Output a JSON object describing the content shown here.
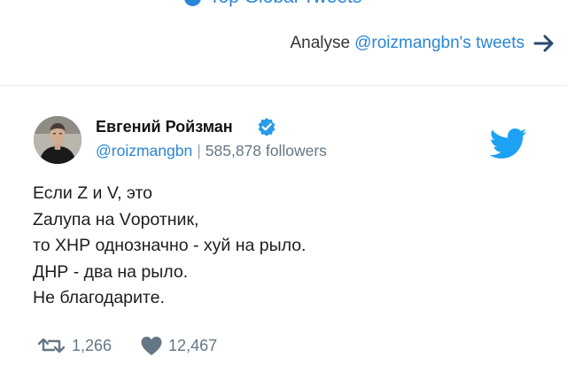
{
  "top_section": {
    "label": "Top Global Tweets"
  },
  "analyse_link": {
    "prefix": "Analyse",
    "handle": "@roizmangbn's tweets",
    "arrow_icon": "arrow-right-icon"
  },
  "tweet": {
    "author_name": "Евгений Ройзман",
    "verified_icon": "verified-badge-icon",
    "handle": "@roizmangbn",
    "separator": "|",
    "followers": "585,878 followers",
    "brand_icon": "twitter-bird-icon",
    "text_lines": [
      "Если Z и V, это",
      "Zалупа на Vоротник,",
      "то ХНР однозначно - хуй на рыло.",
      "ДНР - два на рыло.",
      "Не благодарите."
    ],
    "retweets": "1,266",
    "likes": "12,467",
    "retweet_icon": "retweet-icon",
    "like_icon": "heart-icon"
  },
  "colors": {
    "accent": "#2a86d6",
    "twitter_blue": "#1da1f2",
    "muted": "#657786",
    "text": "#1d1d1d",
    "header_arrow": "#2c4a6e"
  }
}
